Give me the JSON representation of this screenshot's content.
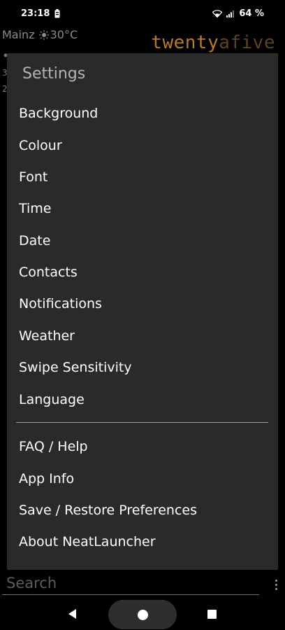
{
  "status_bar": {
    "time": "23:18",
    "battery": "64 %",
    "icons": [
      "battery-saver-icon",
      "wifi-icon",
      "signal-icon"
    ]
  },
  "background": {
    "weather_city": "Mainz",
    "weather_temp": "30°C",
    "weather_icon": "sun-icon",
    "clock_main": "twenty",
    "clock_dim": "afive",
    "clock_color": "#b87c24",
    "line1": "",
    "line2": "3",
    "line3": "2"
  },
  "dialog": {
    "title": "Settings",
    "items": [
      {
        "label": "Background"
      },
      {
        "label": "Colour"
      },
      {
        "label": "Font"
      },
      {
        "label": "Time"
      },
      {
        "label": "Date"
      },
      {
        "label": "Contacts"
      },
      {
        "label": "Notifications"
      },
      {
        "label": "Weather"
      },
      {
        "label": "Swipe Sensitivity"
      },
      {
        "label": "Language"
      }
    ],
    "secondary_items": [
      {
        "label": "FAQ / Help"
      },
      {
        "label": "App Info"
      },
      {
        "label": "Save / Restore Preferences"
      },
      {
        "label": "About NeatLauncher"
      }
    ],
    "background_color": "#2a2a2a"
  },
  "search": {
    "placeholder": "Search"
  },
  "nav": {
    "icons": [
      "back-icon",
      "home-icon",
      "recents-icon"
    ]
  }
}
